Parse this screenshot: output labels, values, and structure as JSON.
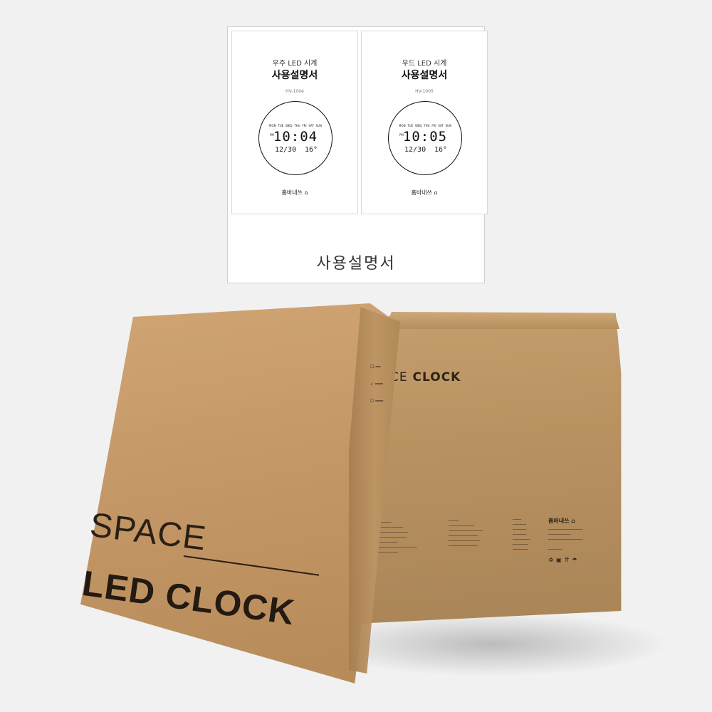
{
  "manual": {
    "caption": "사용설명서",
    "cards": [
      {
        "subtitle": "우주 LED 시계",
        "title": "사용설명서",
        "model": "HV-1004",
        "days": [
          "MON",
          "TUE",
          "WED",
          "THU",
          "FRI",
          "SAT",
          "SUN"
        ],
        "pm": "PM",
        "time": "10:04",
        "date": "12/30",
        "temp": "16°",
        "brand": "홈바내쓰"
      },
      {
        "subtitle": "우드 LED 시계",
        "title": "사용설명서",
        "model": "HV-1005",
        "days": [
          "MON",
          "TUE",
          "WED",
          "THU",
          "FRI",
          "SAT",
          "SUN"
        ],
        "pm": "PM",
        "time": "10:05",
        "date": "12/30",
        "temp": "16°",
        "brand": "홈바내쓰"
      }
    ]
  },
  "front_box": {
    "line1": "SPACE",
    "line2": "LED CLOCK"
  },
  "back_box": {
    "title_prefix": "CE",
    "title_bold": "CLOCK",
    "brand": "홈바내쓰"
  },
  "colors": {
    "background": "#f1f1f1",
    "cardboard": "#c49866",
    "ink": "#231a12"
  }
}
